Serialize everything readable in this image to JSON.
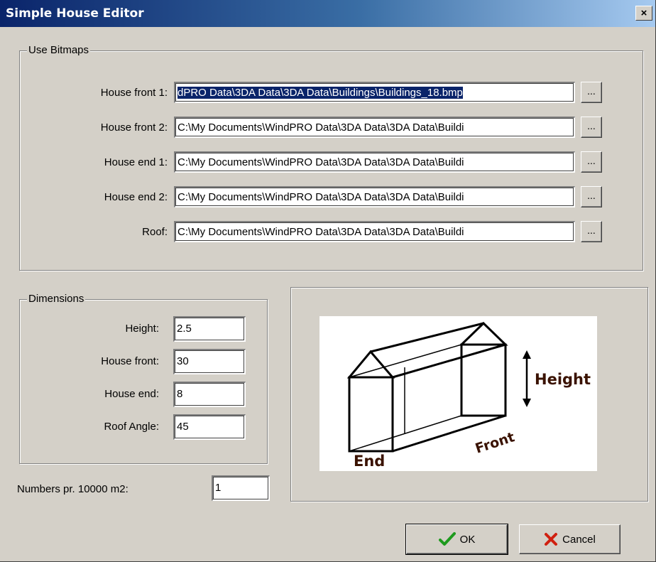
{
  "window": {
    "title": "Simple House Editor",
    "close_label": "×"
  },
  "bitmaps": {
    "group_label": "Use Bitmaps",
    "rows": [
      {
        "label": "House front 1:",
        "value": "dPRO Data\\3DA Data\\3DA Data\\Buildings\\Buildings_18.bmp",
        "browse": "..."
      },
      {
        "label": "House front 2:",
        "value": "C:\\My Documents\\WindPRO Data\\3DA Data\\3DA Data\\Buildi",
        "browse": "..."
      },
      {
        "label": "House end 1:",
        "value": "C:\\My Documents\\WindPRO Data\\3DA Data\\3DA Data\\Buildi",
        "browse": "..."
      },
      {
        "label": "House end 2:",
        "value": "C:\\My Documents\\WindPRO Data\\3DA Data\\3DA Data\\Buildi",
        "browse": "..."
      },
      {
        "label": "Roof:",
        "value": "C:\\My Documents\\WindPRO Data\\3DA Data\\3DA Data\\Buildi",
        "browse": "..."
      }
    ]
  },
  "dimensions": {
    "group_label": "Dimensions",
    "rows": [
      {
        "label": "Height:",
        "value": "2.5"
      },
      {
        "label": "House front:",
        "value": "30"
      },
      {
        "label": "House end:",
        "value": "8"
      },
      {
        "label": "Roof Angle:",
        "value": "45"
      }
    ]
  },
  "numbers": {
    "label": "Numbers pr. 10000 m2:",
    "value": "1"
  },
  "diagram": {
    "height_label": "Height",
    "front_label": "Front",
    "end_label": "End"
  },
  "buttons": {
    "ok": "OK",
    "cancel": "Cancel"
  },
  "colors": {
    "title_start": "#0a246a",
    "title_end": "#a6caf0",
    "label_text": "#3a1200",
    "ok_check": "#1e9a1e",
    "cancel_x": "#d02010"
  }
}
